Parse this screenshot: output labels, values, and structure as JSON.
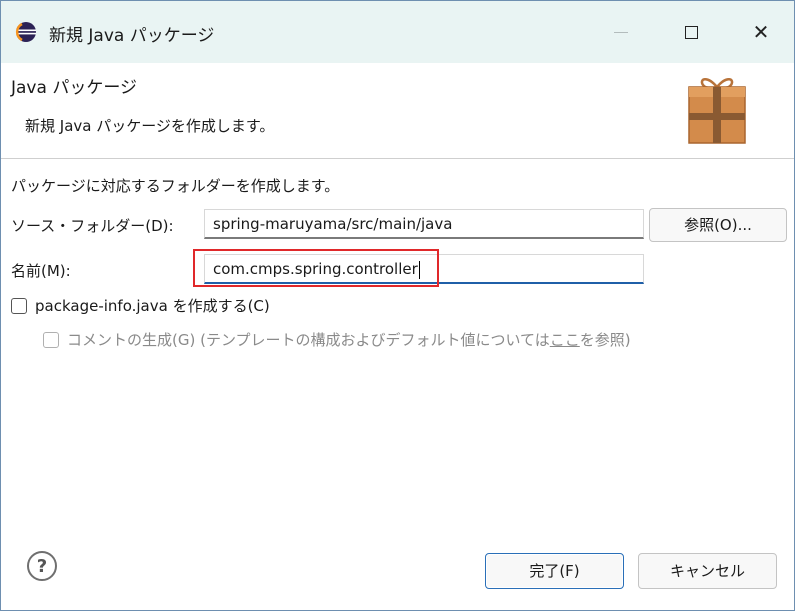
{
  "window": {
    "title": "新規 Java パッケージ",
    "app_icon": "eclipse-icon",
    "controls": {
      "minimize": "minimize-icon",
      "maximize": "maximize-icon",
      "close_glyph": "✕"
    }
  },
  "header": {
    "title": "Java パッケージ",
    "description": "新規 Java パッケージを作成します。",
    "icon": "package-gift-icon"
  },
  "form": {
    "intro": "パッケージに対応するフォルダーを作成します。",
    "source_folder_label": "ソース・フォルダー(D):",
    "source_folder_value": "spring-maruyama/src/main/java",
    "browse_label": "参照(O)...",
    "name_label": "名前(M):",
    "name_value": "com.cmps.spring.controller",
    "package_info_label": "package-info.java を作成する(C)",
    "comment_label_before": "コメントの生成(G) (テンプレートの構成およびデフォルト値については",
    "comment_link": "ここ",
    "comment_label_after": "を参照)"
  },
  "footer": {
    "help_glyph": "?",
    "finish_label": "完了(F)",
    "cancel_label": "キャンセル"
  },
  "colors": {
    "titlebar_bg": "#e9f4f3",
    "highlight": "#e0282a",
    "focus_underline": "#1f5fa8"
  }
}
